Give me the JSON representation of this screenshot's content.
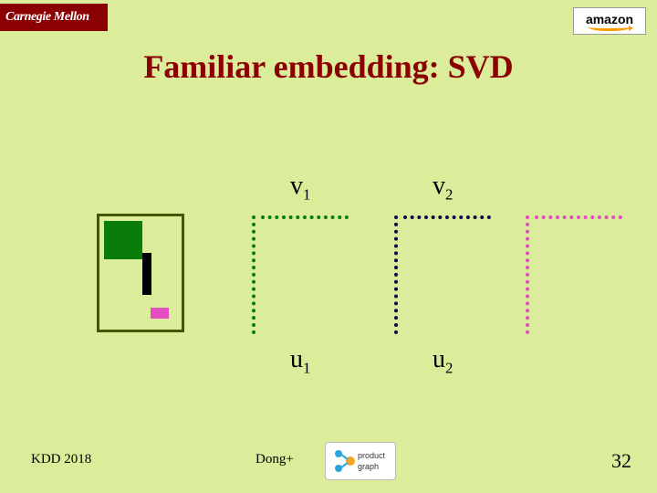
{
  "badges": {
    "cmu": "Carnegie Mellon",
    "amazon": "amazon"
  },
  "title": "Familiar embedding: SVD",
  "labels": {
    "v1_main": "v",
    "v1_sub": "1",
    "v2_main": "v",
    "v2_sub": "2",
    "u1_main": "u",
    "u1_sub": "1",
    "u2_main": "u",
    "u2_sub": "2"
  },
  "footer": {
    "left": "KDD 2018",
    "center": "Dong+",
    "badge_text_top": "product",
    "badge_text_bottom": "graph",
    "page": "32"
  }
}
